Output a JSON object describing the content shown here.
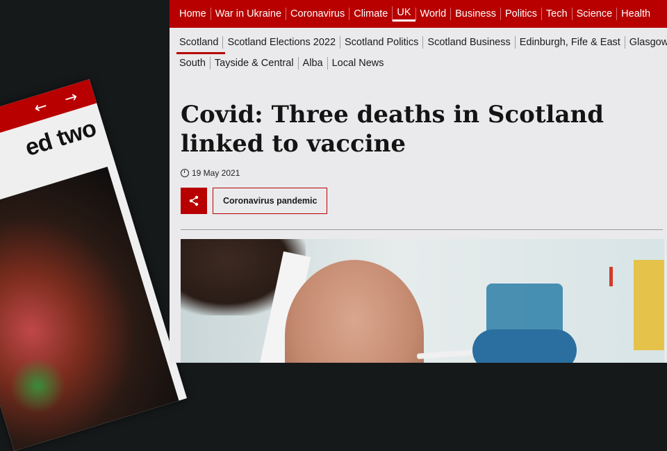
{
  "background_card": {
    "headline_fragment": "ed two",
    "arrows": "← →"
  },
  "top_nav": {
    "items": [
      "Home",
      "War in Ukraine",
      "Coronavirus",
      "Climate",
      "UK",
      "World",
      "Business",
      "Politics",
      "Tech",
      "Science",
      "Health"
    ],
    "active_index": 4
  },
  "sub_nav": {
    "row1": [
      "Scotland",
      "Scotland Elections 2022",
      "Scotland Politics",
      "Scotland Business",
      "Edinburgh, Fife & East",
      "Glasgow"
    ],
    "row2": [
      "South",
      "Tayside & Central",
      "Alba",
      "Local News"
    ],
    "current": "Scotland"
  },
  "article": {
    "headline": "Covid: Three deaths in Scotland linked to vaccine",
    "date": "19 May 2021",
    "topic_tag": "Coronavirus pandemic"
  },
  "colors": {
    "brand_red": "#b80000",
    "page_bg": "#eaeaec"
  },
  "icons": [
    "clock-icon",
    "share-icon",
    "arrow-left-icon",
    "arrow-right-icon"
  ]
}
